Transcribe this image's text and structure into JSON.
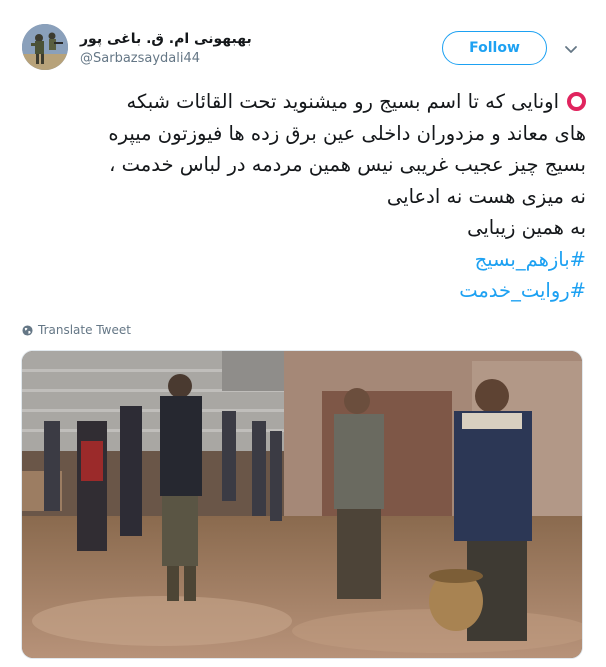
{
  "author": {
    "display_name": "بهبهونی ام. ق. باغی پور",
    "handle": "@Sarbazsaydali44"
  },
  "follow_label": "Follow",
  "tweet": {
    "lines": [
      "اونایی که تا اسم بسیج رو میشنوید تحت القائات شبکه",
      "های معاند و مزدوران داخلی عین برق زده ها فیوزتون میپره",
      "بسیج چیز عجیب غریبی نیس همین مردمه در  لباس خدمت ،",
      "نه میزی هست نه ادعایی",
      "به همین زیبایی"
    ],
    "hashtags": [
      "#بازهم_بسیج",
      "#روایت_خدمت"
    ]
  },
  "translate_label": "Translate Tweet",
  "colors": {
    "accent": "#1da1f2",
    "ring": "#e0245e",
    "text": "#14171a",
    "secondary": "#657786"
  },
  "icons": [
    "follow-caret-icon",
    "globe-icon",
    "red-circle-emoji"
  ]
}
